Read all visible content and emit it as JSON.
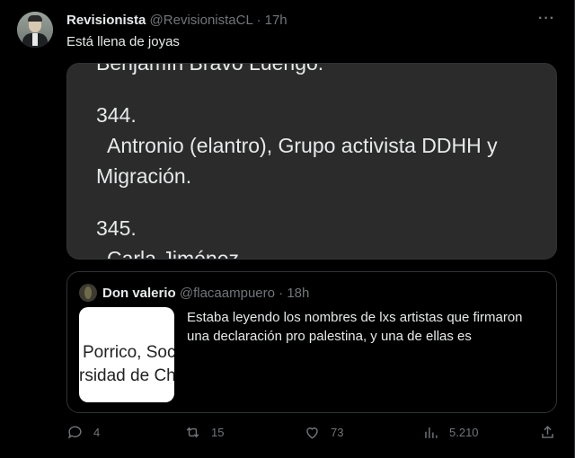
{
  "tweet": {
    "name": "Revisionista",
    "handle": "@RevisionistaCL",
    "dot": "·",
    "time": "17h",
    "more_label": "···",
    "text": "Está llena de joyas"
  },
  "media": {
    "lines": [
      "Benjamín Bravo Luengo.",
      "344.",
      "Antronio (elantro), Grupo activista DDHH y",
      "Migración.",
      "345.",
      "Carla Jiménez"
    ]
  },
  "quote": {
    "name": "Don valerio",
    "handle": "@flacaampuero",
    "dot": "·",
    "time": "18h",
    "thumb_lines": [
      "Porrico, Soc",
      "rsidad de Ch"
    ],
    "text": "Estaba leyendo los nombres de lxs artistas que firmaron una declaración pro palestina, y una de ellas es"
  },
  "actions": {
    "replies": "4",
    "reposts": "15",
    "likes": "73",
    "views": "5.210"
  }
}
